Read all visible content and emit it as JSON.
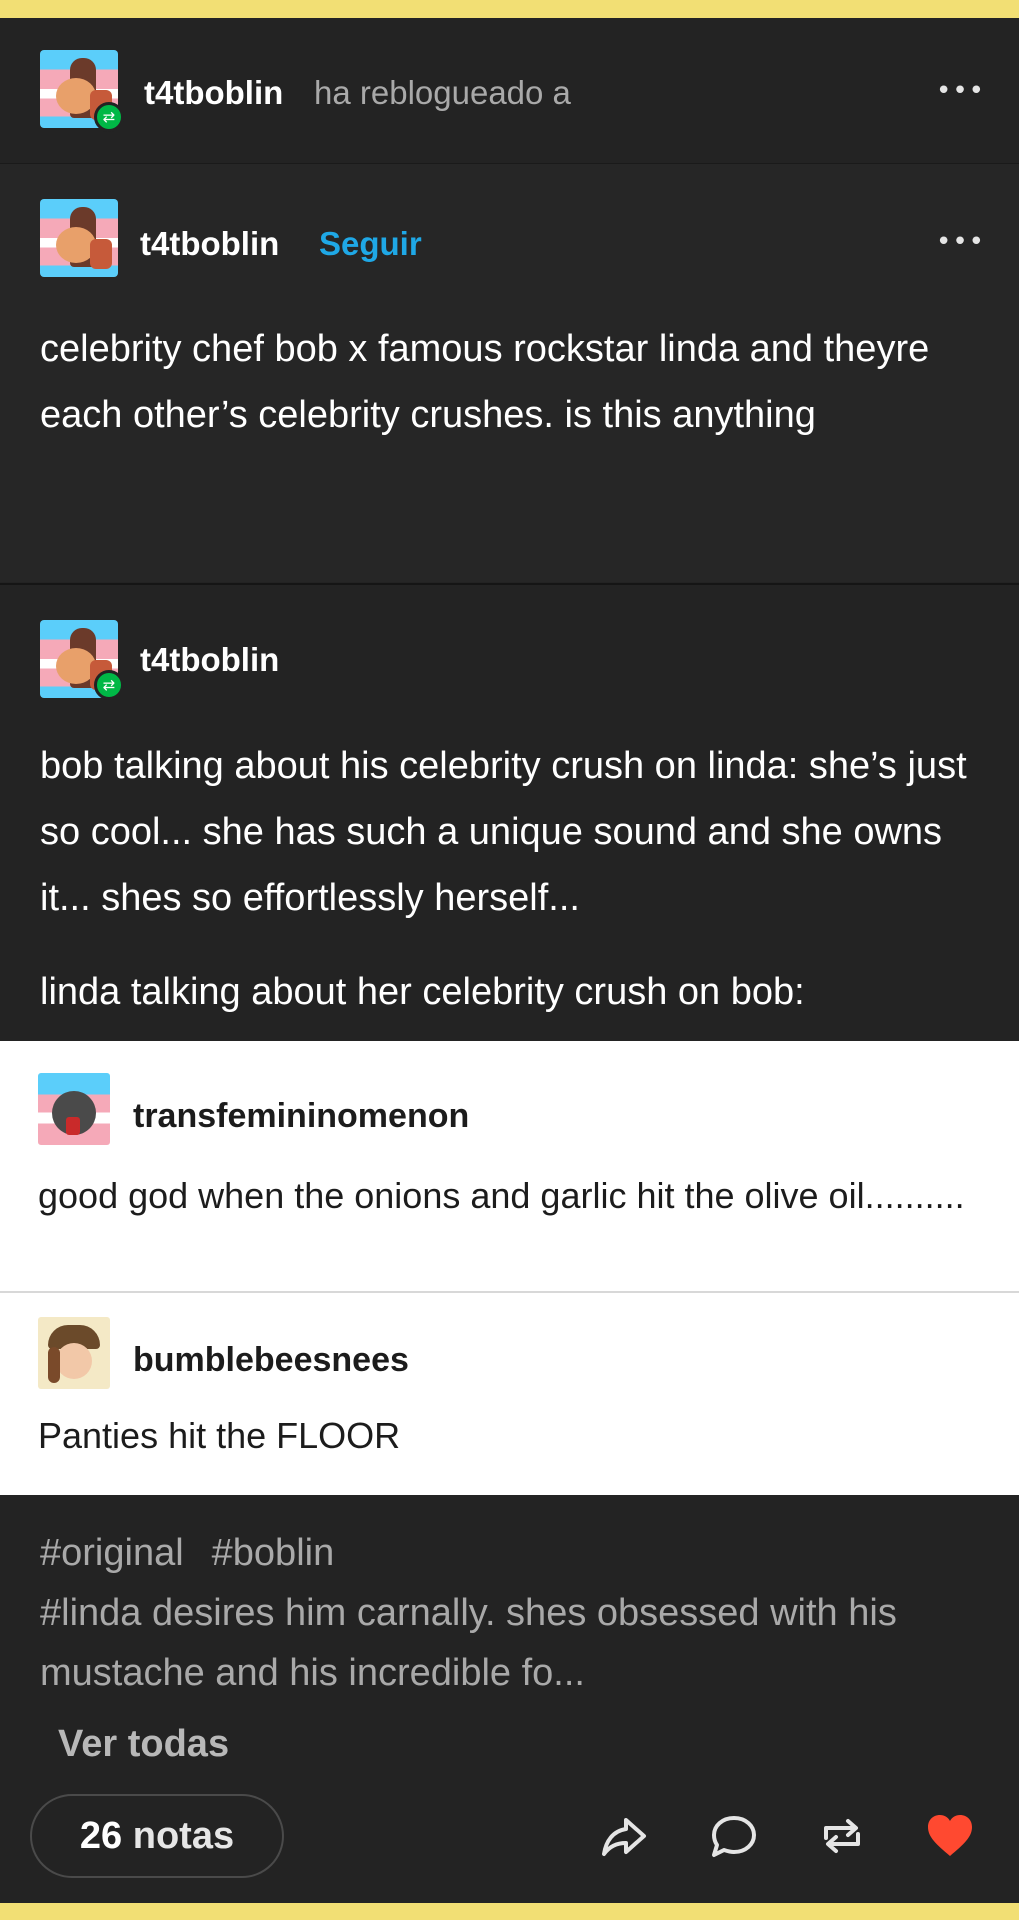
{
  "header": {
    "username": "t4tboblin",
    "action_text": "ha reblogueado a",
    "menu": "•••"
  },
  "original_post": {
    "username": "t4tboblin",
    "follow_label": "Seguir",
    "menu": "•••",
    "text": "celebrity chef bob x famous rockstar linda and theyre each other’s celebrity crushes. is this anything"
  },
  "reblog": {
    "username": "t4tboblin",
    "paragraph1": "bob talking about his celebrity crush on linda: she’s just so cool... she has such a unique sound and she owns it... shes so effortlessly herself...",
    "paragraph2": "linda talking about her celebrity crush on bob:"
  },
  "quoted": [
    {
      "username": "transfemininomenon",
      "text": "good god when the onions and garlic hit the olive oil.........."
    },
    {
      "username": "bumblebeesnees",
      "text": "Panties hit the FLOOR"
    }
  ],
  "tags": {
    "tag1": "#original",
    "tag2": "#boblin",
    "tag3": "#linda desires him carnally. shes obsessed with his mustache and his incredible fo...",
    "see_all": "Ver todas"
  },
  "footer": {
    "notes_count": "26",
    "notes_label": "notas"
  },
  "icons": {
    "share": "share-icon",
    "reply": "comment-icon",
    "reblog": "reblog-icon",
    "like": "heart-icon"
  },
  "colors": {
    "follow": "#1fa8e6",
    "reblog_badge": "#00b846",
    "like": "#ff4930",
    "frame": "#f2df74"
  }
}
